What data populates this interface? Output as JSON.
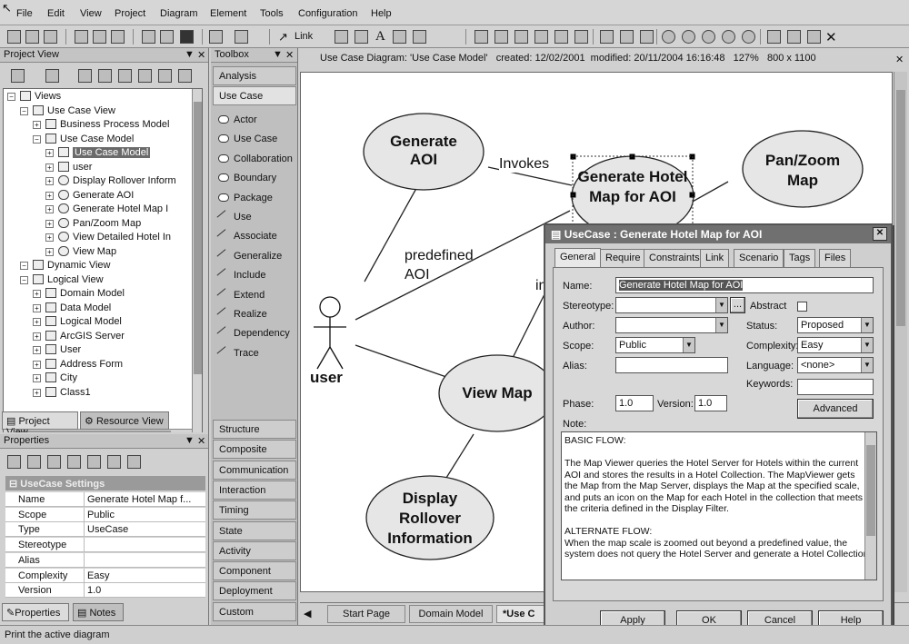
{
  "menu": [
    "File",
    "Edit",
    "View",
    "Project",
    "Diagram",
    "Element",
    "Tools",
    "Configuration",
    "Help"
  ],
  "toolbar": {
    "link_label": "Link"
  },
  "project_view": {
    "title": "Project View",
    "tree": [
      {
        "label": "Views",
        "depth": 0
      },
      {
        "label": "Use Case View",
        "depth": 1
      },
      {
        "label": "Business Process Model",
        "depth": 2
      },
      {
        "label": "Use Case Model",
        "depth": 2
      },
      {
        "label": "Use Case Model",
        "depth": 3,
        "selected": true
      },
      {
        "label": "user",
        "depth": 3
      },
      {
        "label": "Display Rollover Inform",
        "depth": 3
      },
      {
        "label": "Generate AOI",
        "depth": 3
      },
      {
        "label": "Generate Hotel Map I",
        "depth": 3
      },
      {
        "label": "Pan/Zoom Map",
        "depth": 3
      },
      {
        "label": "View Detailed Hotel In",
        "depth": 3
      },
      {
        "label": "View Map",
        "depth": 3
      },
      {
        "label": "Dynamic View",
        "depth": 1
      },
      {
        "label": "Logical View",
        "depth": 1
      },
      {
        "label": "Domain Model",
        "depth": 2
      },
      {
        "label": "Data Model",
        "depth": 2
      },
      {
        "label": "Logical Model",
        "depth": 2
      },
      {
        "label": "ArcGIS Server",
        "depth": 2
      },
      {
        "label": "User",
        "depth": 2
      },
      {
        "label": "Address Form",
        "depth": 2
      },
      {
        "label": "City",
        "depth": 2
      },
      {
        "label": "Class1",
        "depth": 2
      }
    ],
    "tabs": [
      "Project View",
      "Resource View"
    ]
  },
  "properties": {
    "title": "Properties",
    "section": "UseCase Settings",
    "rows": [
      {
        "name": "Name",
        "value": "Generate Hotel Map f..."
      },
      {
        "name": "Scope",
        "value": "Public"
      },
      {
        "name": "Type",
        "value": "UseCase"
      },
      {
        "name": "Stereotype",
        "value": ""
      },
      {
        "name": "Alias",
        "value": ""
      },
      {
        "name": "Complexity",
        "value": "Easy"
      },
      {
        "name": "Version",
        "value": "1.0"
      }
    ],
    "tabs": [
      "Properties",
      "Notes"
    ]
  },
  "toolbox": {
    "title": "Toolbox",
    "top_sections": [
      "Analysis",
      "Use Case"
    ],
    "items": [
      "Actor",
      "Use Case",
      "Collaboration",
      "Boundary",
      "Package",
      "Use",
      "Associate",
      "Generalize",
      "Include",
      "Extend",
      "Realize",
      "Dependency",
      "Trace"
    ],
    "sections": [
      "Structure",
      "Composite",
      "Communication",
      "Interaction",
      "Timing",
      "State",
      "Activity",
      "Component",
      "Deployment",
      "Custom"
    ]
  },
  "diagram": {
    "header": "Use Case Diagram: 'Use Case Model'   created: 12/02/2001  modified: 20/11/2004 16:16:48   127%   800 x 1100",
    "usecases": {
      "generate_aoi": "Generate AOI",
      "generate_hotel_map": "Generate Hotel Map for AOI",
      "pan_zoom": "Pan/Zoom Map",
      "view_map": "View Map",
      "display_rollover": "Display Rollover Information"
    },
    "actor": "user",
    "labels": {
      "invokes": "Invokes",
      "predefined": "predefined AOI",
      "partial": "in"
    },
    "tabs": [
      "Start Page",
      "Domain Model",
      "*Use C"
    ]
  },
  "dialog": {
    "title": "UseCase : Generate Hotel Map for AOI",
    "tabs": [
      "General",
      "Require",
      "Constraints",
      "Link",
      "Scenario",
      "Tags",
      "Files"
    ],
    "name_label": "Name:",
    "name_value": "Generate Hotel Map for AOI",
    "stereotype_label": "Stereotype:",
    "abstract_label": "Abstract",
    "author_label": "Author:",
    "status_label": "Status:",
    "status_value": "Proposed",
    "scope_label": "Scope:",
    "scope_value": "Public",
    "complexity_label": "Complexity:",
    "complexity_value": "Easy",
    "alias_label": "Alias:",
    "language_label": "Language:",
    "language_value": "<none>",
    "keywords_label": "Keywords:",
    "advanced_label": "Advanced",
    "phase_label": "Phase:",
    "phase_value": "1.0",
    "version_label": "Version:",
    "version_value": "1.0",
    "note_label": "Note:",
    "note_lines": [
      "BASIC FLOW:",
      "",
      "The Map Viewer queries the Hotel Server for Hotels within the current",
      "AOI and stores the results in a Hotel Collection.  The MapViewer gets",
      "the Map from the Map Server, displays the Map at the specified scale,",
      "and puts an icon on the Map for each Hotel in the collection that meets",
      "the criteria defined in the Display Filter.",
      "",
      "ALTERNATE FLOW:",
      "When the map scale is zoomed out beyond a predefined value, the",
      "system does not query the Hotel Server and generate a Hotel Collection."
    ],
    "buttons": {
      "apply": "Apply",
      "ok": "OK",
      "cancel": "Cancel",
      "help": "Help"
    }
  },
  "status_bar": "Print the active diagram"
}
